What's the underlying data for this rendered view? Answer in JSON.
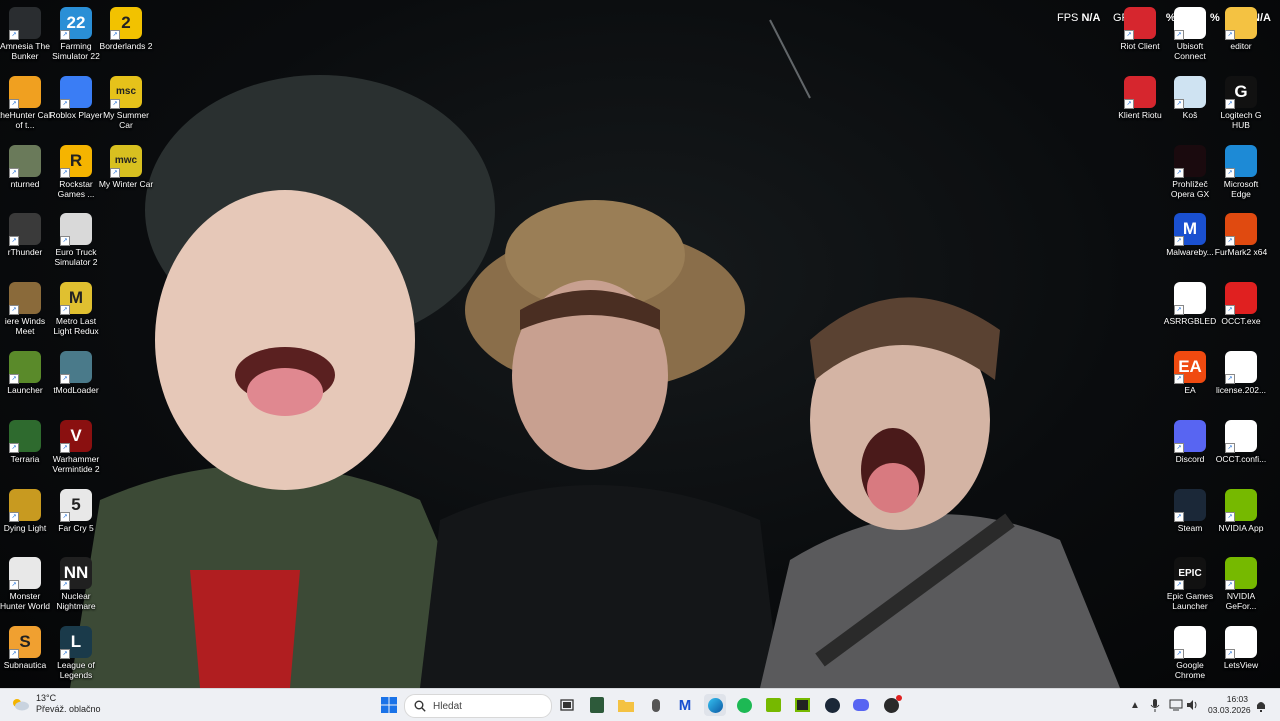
{
  "overlay": {
    "fps_label": "FPS",
    "fps_value": "N/A",
    "gpu_label": "GPU",
    "gpu_value": "%",
    "cpu_label": "C",
    "cpu_value": "%",
    "extra_value": "N/A"
  },
  "desktop_left": [
    {
      "label": "Amnesia The Bunker",
      "icon": "amnesia-icon",
      "color": "#2a2d30"
    },
    {
      "label": "Farming Simulator 22",
      "icon": "farming-sim-icon",
      "color": "#2a8fd6",
      "glyph": "22"
    },
    {
      "label": "Borderlands 2",
      "icon": "borderlands-icon",
      "color": "#f2c200",
      "glyph": "2"
    },
    {
      "label": "theHunter Call of t...",
      "icon": "hunter-icon",
      "color": "#f0a020"
    },
    {
      "label": "Roblox Player",
      "icon": "roblox-icon",
      "color": "#3a7df5"
    },
    {
      "label": "My Summer Car",
      "icon": "msc-icon",
      "color": "#e6c21a",
      "glyph": "msc"
    },
    {
      "label": "nturned",
      "icon": "unturned-icon",
      "color": "#6a7a5a"
    },
    {
      "label": "Rockstar Games ...",
      "icon": "rockstar-icon",
      "color": "#f5b400",
      "glyph": "R"
    },
    {
      "label": "My Winter Car",
      "icon": "mwc-icon",
      "color": "#d8c020",
      "glyph": "mwc"
    },
    {
      "label": "rThunder",
      "icon": "warthunder-icon",
      "color": "#3a3a3a"
    },
    {
      "label": "Euro Truck Simulator 2",
      "icon": "ets2-icon",
      "color": "#d9d9d9"
    },
    {
      "label": "iere Winds Meet",
      "icon": "winds-meet-icon",
      "color": "#8a6a3a"
    },
    {
      "label": "Metro Last Light Redux",
      "icon": "metro-icon",
      "color": "#e0c030",
      "glyph": "M"
    },
    {
      "label": "Launcher",
      "icon": "minecraft-launcher-icon",
      "color": "#5a8a2a"
    },
    {
      "label": "tModLoader",
      "icon": "tmodloader-icon",
      "color": "#4a7a8a"
    },
    {
      "label": "Terraria",
      "icon": "terraria-icon",
      "color": "#2e6a2e"
    },
    {
      "label": "Warhammer Vermintide 2",
      "icon": "vermintide-icon",
      "color": "#8a1010",
      "glyph": "V"
    },
    {
      "label": "Dying Light",
      "icon": "dying-light-icon",
      "color": "#c89a20"
    },
    {
      "label": "Far Cry 5",
      "icon": "farcry5-icon",
      "color": "#e8e8e8",
      "glyph": "5"
    },
    {
      "label": "Monster Hunter World",
      "icon": "monster-hunter-icon",
      "color": "#e8e8e8"
    },
    {
      "label": "Nuclear Nightmare",
      "icon": "nuclear-nightmare-icon",
      "color": "#202020",
      "glyph": "NN"
    },
    {
      "label": "Subnautica",
      "icon": "subnautica-icon",
      "color": "#f0a030",
      "glyph": "S"
    },
    {
      "label": "League of Legends",
      "icon": "league-icon",
      "color": "#1a3a4a",
      "glyph": "L"
    }
  ],
  "desktop_right": [
    {
      "label": "Riot Client",
      "icon": "riot-client-icon",
      "color": "#d6262e"
    },
    {
      "label": "Ubisoft Connect",
      "icon": "ubisoft-icon",
      "color": "#ffffff"
    },
    {
      "label": "editor",
      "icon": "folder-icon",
      "color": "#f4c242"
    },
    {
      "label": "Klient Riotu",
      "icon": "riot-client-icon",
      "color": "#d6262e"
    },
    {
      "label": "Koš",
      "icon": "recycle-bin-icon",
      "color": "#cfe3f2"
    },
    {
      "label": "Logitech G HUB",
      "icon": "logitech-icon",
      "color": "#111111",
      "glyph": "G"
    },
    {
      "label": "Prohlížeč Opera GX",
      "icon": "opera-gx-icon",
      "color": "#1a0a0e"
    },
    {
      "label": "Microsoft Edge",
      "icon": "edge-icon",
      "color": "#1d8ad6"
    },
    {
      "label": "Malwareby...",
      "icon": "malwarebytes-icon",
      "color": "#1a50d0",
      "glyph": "M"
    },
    {
      "label": "FurMark2 x64",
      "icon": "furmark-icon",
      "color": "#e04a10"
    },
    {
      "label": "ASRRGBLED",
      "icon": "asrock-icon",
      "color": "#ffffff"
    },
    {
      "label": "OCCT.exe",
      "icon": "occt-icon",
      "color": "#e02020"
    },
    {
      "label": "EA",
      "icon": "ea-icon",
      "color": "#f04a10",
      "glyph": "EA"
    },
    {
      "label": "license.202...",
      "icon": "file-icon",
      "color": "#ffffff"
    },
    {
      "label": "Discord",
      "icon": "discord-icon",
      "color": "#5865f2"
    },
    {
      "label": "OCCT.confi...",
      "icon": "file-icon",
      "color": "#ffffff"
    },
    {
      "label": "Steam",
      "icon": "steam-icon",
      "color": "#1b2838"
    },
    {
      "label": "NVIDIA App",
      "icon": "nvidia-icon",
      "color": "#76b900"
    },
    {
      "label": "Epic Games Launcher",
      "icon": "epic-games-icon",
      "color": "#111111",
      "glyph": "EPIC"
    },
    {
      "label": "NVIDIA GeFor...",
      "icon": "nvidia-icon",
      "color": "#76b900"
    },
    {
      "label": "Google Chrome",
      "icon": "chrome-icon",
      "color": "#ffffff"
    },
    {
      "label": "LetsView",
      "icon": "letsview-icon",
      "color": "#ffffff"
    }
  ],
  "weather": {
    "temp": "13°C",
    "desc": "Převáž. oblačno"
  },
  "search": {
    "placeholder": "Hledat"
  },
  "taskbar_apps": [
    "start-icon",
    "search-icon",
    "task-view-icon",
    "folder-app-icon",
    "file-explorer-icon",
    "mouse-app-icon",
    "malwarebytes-icon",
    "edge-icon",
    "spotify-icon",
    "nvidia-icon",
    "nvidia-overlay-icon",
    "steam-icon",
    "discord-icon",
    "obs-icon"
  ],
  "clock": {
    "time": "16:03",
    "date": "03.03.2026"
  }
}
